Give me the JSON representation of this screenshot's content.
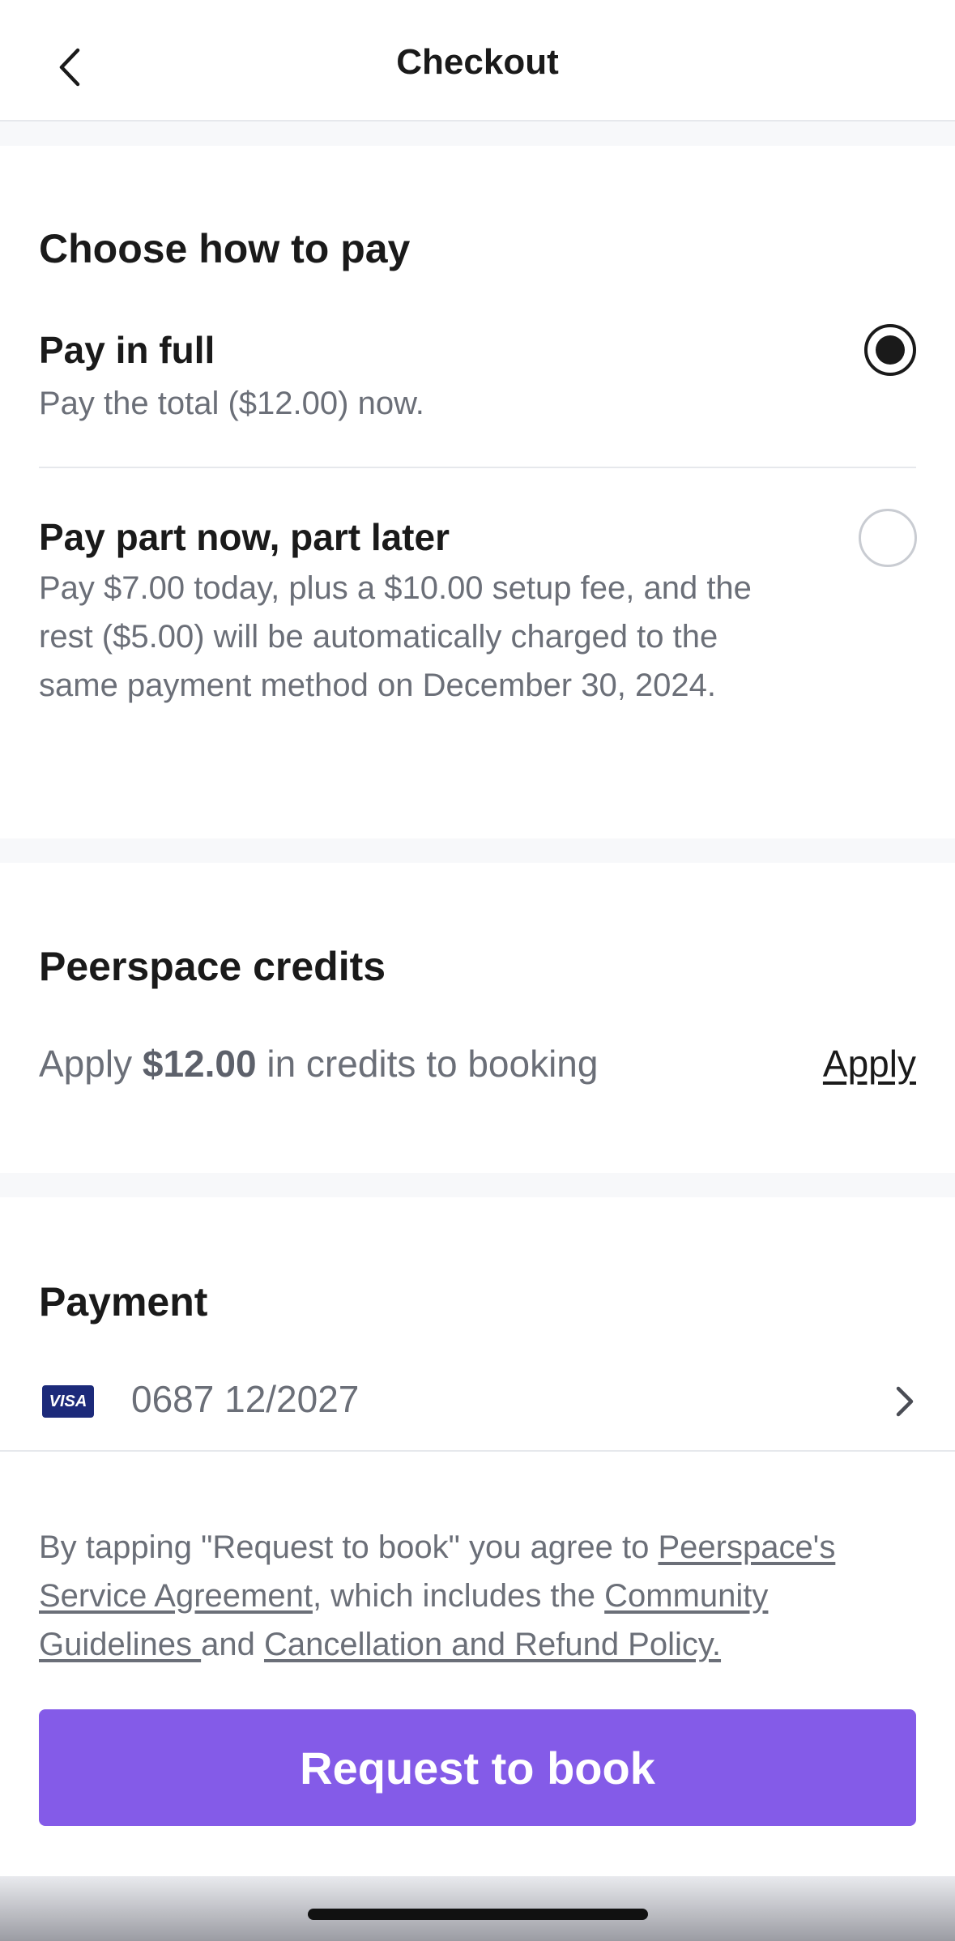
{
  "header": {
    "title": "Checkout",
    "back_icon": "chevron-left-icon"
  },
  "pay_section": {
    "title": "Choose how to pay",
    "options": [
      {
        "title": "Pay in full",
        "description": "Pay the total ($12.00) now.",
        "selected": true
      },
      {
        "title": "Pay part now, part later",
        "description": "Pay $7.00 today, plus a $10.00 setup fee, and the rest ($5.00) will be automatically charged to the same payment method on December 30, 2024.",
        "selected": false
      }
    ]
  },
  "credits_section": {
    "title": "Peerspace credits",
    "text_before": "Apply ",
    "amount": "$12.00",
    "text_after": " in credits to booking",
    "apply_label": "Apply"
  },
  "payment_section": {
    "title": "Payment",
    "card_brand": "VISA",
    "card_text": "0687 12/2027",
    "chevron_icon": "chevron-right-icon"
  },
  "terms": {
    "prefix": "By tapping \"Request to book\" you agree to ",
    "link_service": "Peerspace's Service Agreement",
    "middle": ", which includes the ",
    "link_community": "Community Guidelines ",
    "and": "and ",
    "link_cancellation": "Cancellation and Refund Policy."
  },
  "cta": {
    "label": "Request to book"
  },
  "colors": {
    "accent": "#845be8",
    "text": "#1a1a1a",
    "muted": "#6b6f78",
    "band": "#f7f8fa"
  }
}
